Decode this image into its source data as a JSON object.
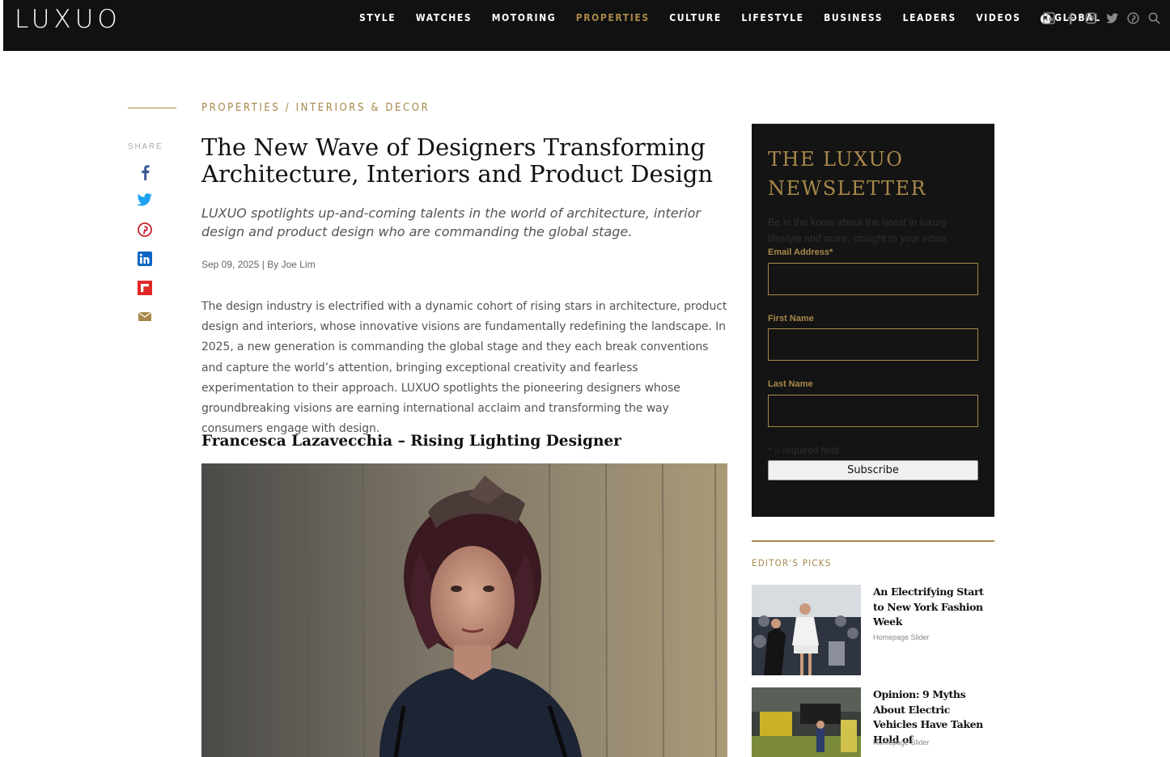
{
  "nav": {
    "logo": "LUXUO",
    "items": [
      {
        "label": "STYLE",
        "active": false
      },
      {
        "label": "WATCHES",
        "active": false
      },
      {
        "label": "MOTORING",
        "active": false
      },
      {
        "label": "PROPERTIES",
        "active": true
      },
      {
        "label": "CULTURE",
        "active": false
      },
      {
        "label": "LIFESTYLE",
        "active": false
      },
      {
        "label": "BUSINESS",
        "active": false
      },
      {
        "label": "LEADERS",
        "active": false
      },
      {
        "label": "VIDEOS",
        "active": false
      }
    ],
    "global_label": "GLOBAL",
    "social_icons": [
      "linkedin-icon",
      "facebook-icon",
      "instagram-icon",
      "twitter-icon",
      "pinterest-icon",
      "search-icon"
    ]
  },
  "share": {
    "label": "SHARE",
    "icons": [
      "facebook-icon",
      "twitter-icon",
      "pinterest-icon",
      "linkedin-icon",
      "flipboard-icon",
      "email-icon"
    ]
  },
  "article": {
    "breadcrumb_section": "PROPERTIES",
    "breadcrumb_separator": "/",
    "breadcrumb_sub": "INTERIORS & DECOR",
    "title": "The New Wave of Designers Transforming Architecture, Interiors and Product Design",
    "dek": "LUXUO spotlights up-and-coming talents in the world of architecture, interior design and product design who are commanding the global stage.",
    "date": "Sep 09, 2025",
    "by": "By",
    "author": "Joe Lim",
    "body": "The design industry is electrified with a dynamic cohort of rising stars in architecture, product design and interiors, whose innovative visions are fundamentally redefining the landscape. In 2025, a new generation is commanding the global stage and they each break conventions and capture the world’s attention, bringing exceptional creativity and fearless experimentation to their approach. LUXUO spotlights the pioneering designers whose groundbreaking visions are earning international acclaim and transforming the way consumers engage with design.",
    "subhead": "Francesca Lazavecchia – Rising Lighting Designer"
  },
  "newsletter": {
    "title": "THE LUXUO NEWSLETTER",
    "description": "Be in the know about the latest in luxury lifestyle and more, straight to your inbox",
    "email_label": "Email Address*",
    "email_value": "",
    "first_name_label": "First Name",
    "first_name_value": "",
    "last_name_label": "Last Name",
    "last_name_value": "",
    "required_note": "* = required field",
    "subscribe_label": "Subscribe"
  },
  "editors_picks": {
    "heading": "EDITOR'S PICKS",
    "items": [
      {
        "title": "An Electrifying Start to New York Fashion Week",
        "category": "Homepage Slider"
      },
      {
        "title": "Opinion: 9 Myths About Electric Vehicles Have Taken Hold of",
        "category": "Homepage Slider"
      }
    ]
  },
  "colors": {
    "accent": "#a8884a",
    "nav_bg": "#111111",
    "panel_bg": "#141414"
  }
}
